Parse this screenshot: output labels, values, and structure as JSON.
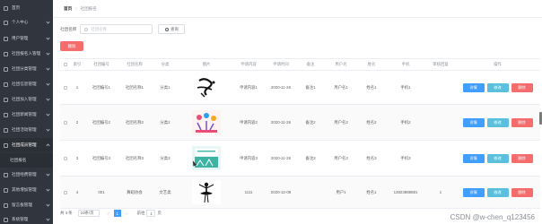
{
  "sidebar": {
    "items": [
      {
        "label": "首页",
        "expandable": false,
        "active": false
      },
      {
        "label": "个人中心",
        "expandable": true,
        "active": false
      },
      {
        "label": "用户管理",
        "expandable": true,
        "active": false
      },
      {
        "label": "社团报名入管理",
        "expandable": true,
        "active": false
      },
      {
        "label": "社团分类管理",
        "expandable": true,
        "active": false
      },
      {
        "label": "社团信息管理",
        "expandable": true,
        "active": false
      },
      {
        "label": "社团加入管理",
        "expandable": true,
        "active": false
      },
      {
        "label": "社团新闻管理",
        "expandable": true,
        "active": false
      },
      {
        "label": "社团活动管理",
        "expandable": true,
        "active": false
      },
      {
        "label": "社团成员管理",
        "expandable": true,
        "active": true
      },
      {
        "label": "社团报名",
        "expandable": false,
        "active": false,
        "sub": true
      },
      {
        "label": "社团经费管理",
        "expandable": true,
        "active": false
      },
      {
        "label": "其他增加管理",
        "expandable": true,
        "active": false
      },
      {
        "label": "留言板管理",
        "expandable": true,
        "active": false
      },
      {
        "label": "系统管理",
        "expandable": true,
        "active": false
      }
    ]
  },
  "breadcrumb": {
    "home": "首页",
    "current": "社团报名"
  },
  "search": {
    "label": "社团名称",
    "placeholder": "社团名称",
    "button": "查询"
  },
  "toolbar": {
    "delete_label": "删除"
  },
  "table": {
    "headers": {
      "index": "索引",
      "code": "社团编号",
      "name": "社团名称",
      "category": "分类",
      "image": "图片",
      "content": "申请内容",
      "time": "申请时间",
      "remark": "备注",
      "user": "用户名",
      "realname": "姓名",
      "phone": "手机",
      "status": "审核回复",
      "ops": "操作"
    },
    "rows": [
      {
        "index": "1",
        "code": "社团编号1",
        "name": "社团名称1",
        "category": "分类1",
        "image": "calligraphy",
        "content": "申请内容1",
        "time": "2020-11-26",
        "remark": "备注1",
        "user": "用户名1",
        "realname": "姓名1",
        "phone": "手机1",
        "status": ""
      },
      {
        "index": "2",
        "code": "社团编号2",
        "name": "社团名称2",
        "category": "分类2",
        "image": "dance-poster",
        "content": "申请内容2",
        "time": "2020-11-26",
        "remark": "备注2",
        "user": "用户名2",
        "realname": "姓名2",
        "phone": "手机2",
        "status": ""
      },
      {
        "index": "3",
        "code": "社团编号3",
        "name": "社团名称3",
        "category": "分类3",
        "image": "teal-banner",
        "content": "申请内容3",
        "time": "2020-11-26",
        "remark": "备注3",
        "user": "用户名3",
        "realname": "姓名3",
        "phone": "手机3",
        "status": ""
      },
      {
        "index": "4",
        "code": "001",
        "name": "舞蹈协会",
        "category": "文艺类",
        "image": "ballet",
        "content": "1111",
        "time": "2020-12-08",
        "remark": "",
        "user": "用户1",
        "realname": "姓名1",
        "phone": "13823888881",
        "status": "1"
      }
    ],
    "ops": {
      "detail": "详情",
      "edit": "修改",
      "delete": "删除"
    }
  },
  "pagination": {
    "total": "共 4 条",
    "size": "10条/页",
    "prev": "<",
    "current_page": "1",
    "next": ">",
    "goto_prefix": "前往",
    "goto_value": "1",
    "goto_suffix": "页"
  },
  "watermark": "CSDN @w-chen_q123456",
  "colors": {
    "sidebar_bg": "#31353d",
    "primary": "#409eff",
    "danger": "#f56c6c",
    "info": "#5bc0de"
  }
}
